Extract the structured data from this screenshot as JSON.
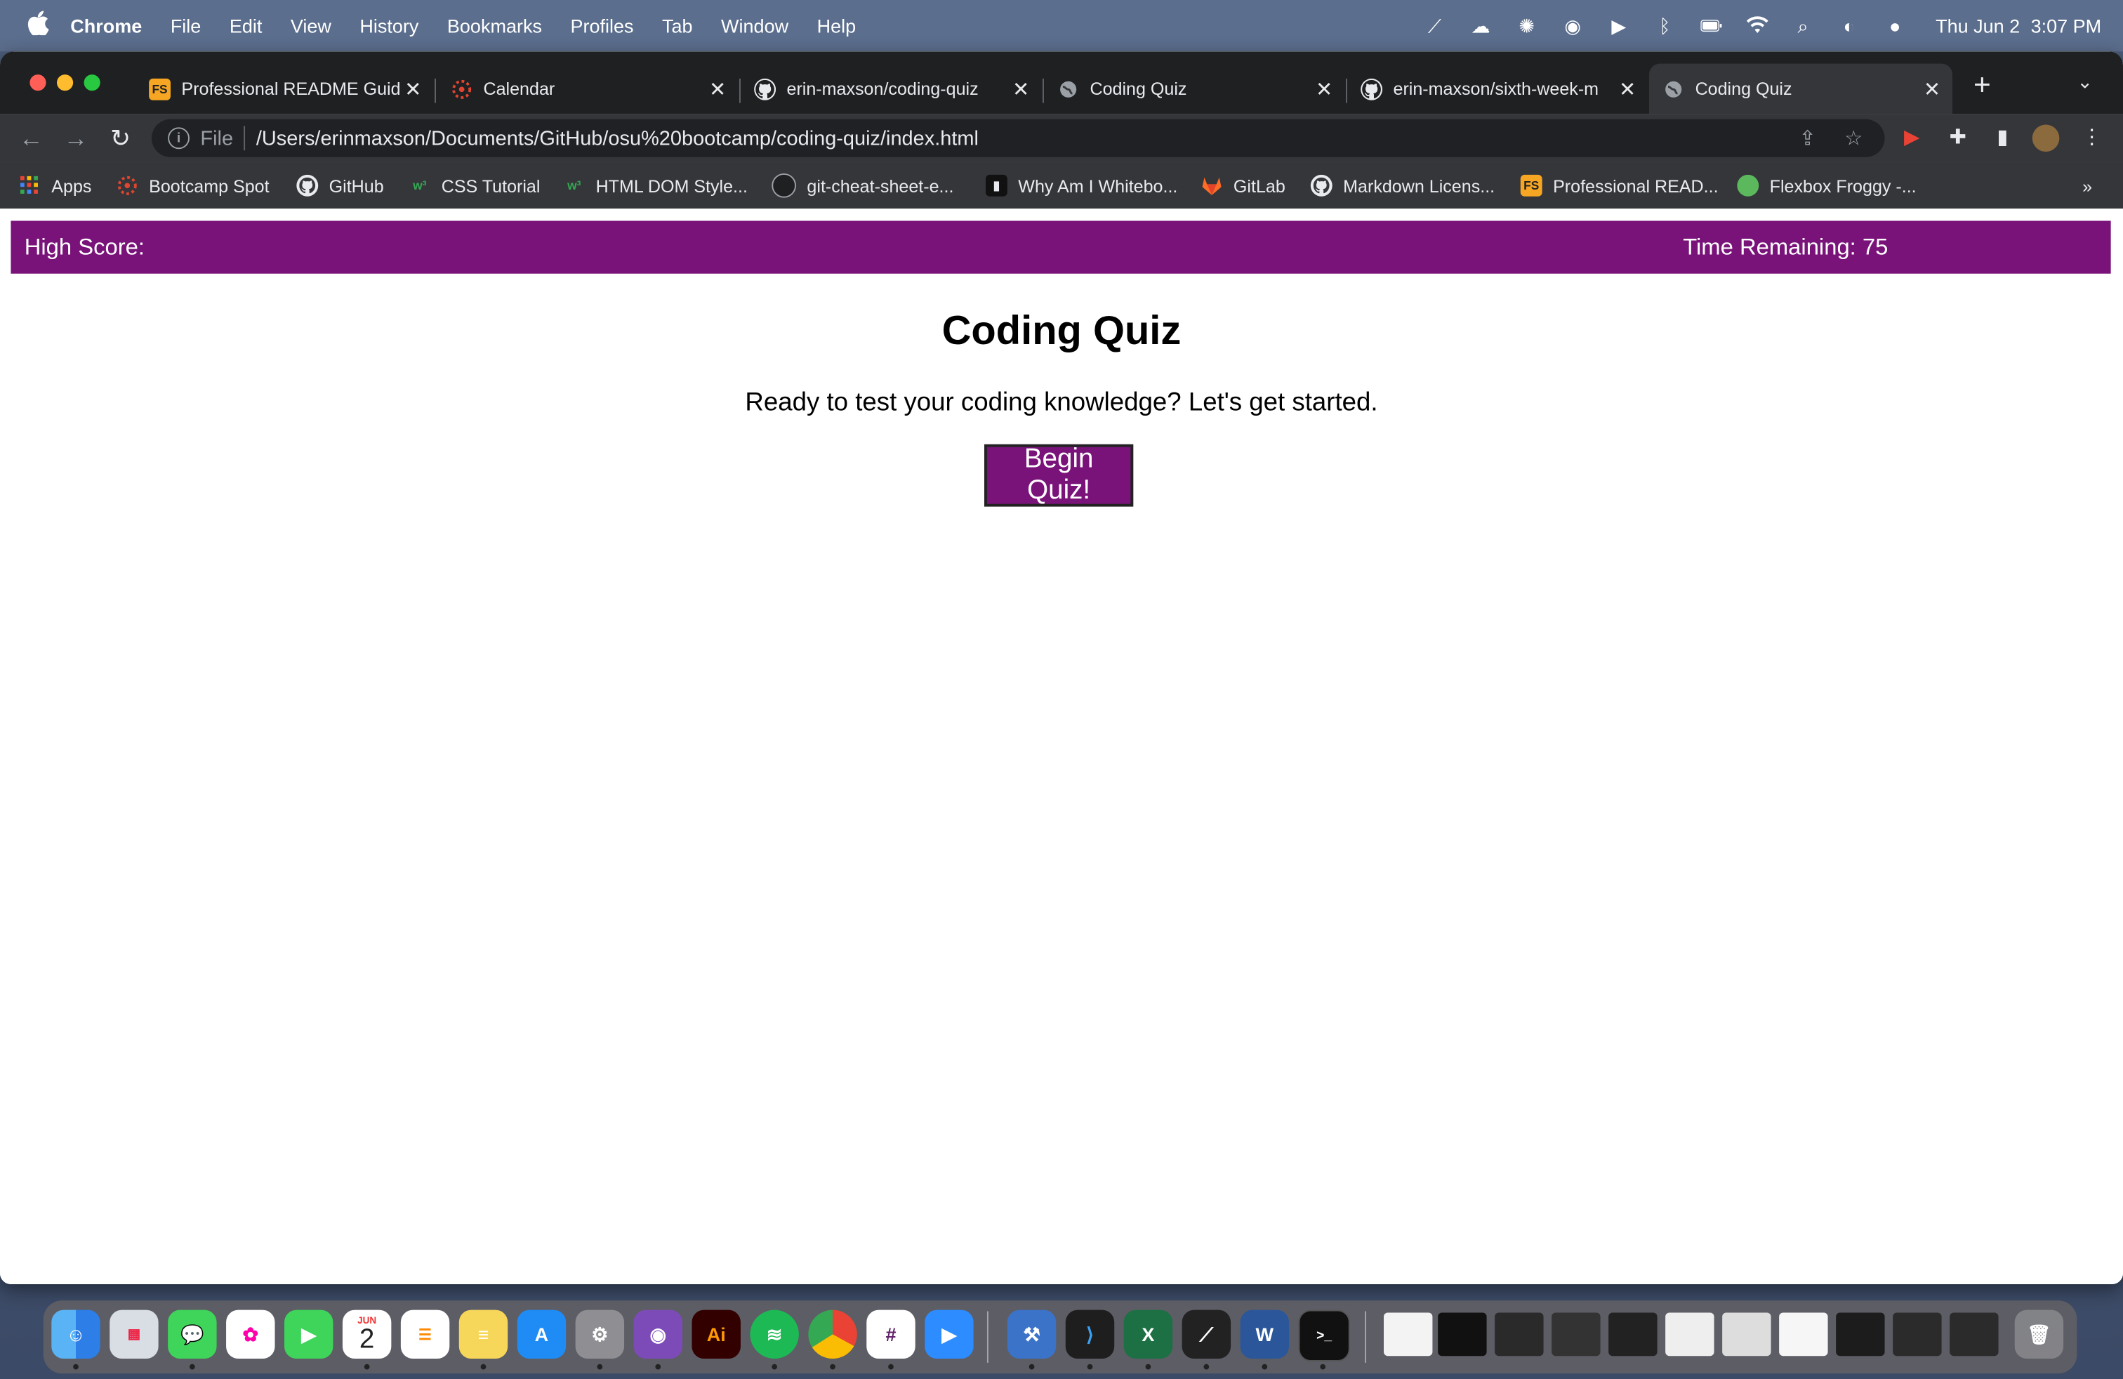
{
  "menubar": {
    "app_name": "Chrome",
    "items": [
      "File",
      "Edit",
      "View",
      "History",
      "Bookmarks",
      "Profiles",
      "Tab",
      "Window",
      "Help"
    ],
    "date": "Thu Jun 2",
    "time": "3:07 PM"
  },
  "tabs": [
    {
      "label": "Professional README Guid",
      "favicon": "FS",
      "favicon_color": "#f6a623",
      "active": false
    },
    {
      "label": "Calendar",
      "favicon": "canvas-icon",
      "favicon_color": "#e0452f",
      "active": false
    },
    {
      "label": "erin-maxson/coding-quiz",
      "favicon": "github-icon",
      "active": false
    },
    {
      "label": "Coding Quiz",
      "favicon": "globe-icon",
      "active": false
    },
    {
      "label": "erin-maxson/sixth-week-m",
      "favicon": "github-icon",
      "active": false
    },
    {
      "label": "Coding Quiz",
      "favicon": "globe-icon",
      "active": true
    }
  ],
  "address_bar": {
    "scheme": "File",
    "url": "/Users/erinmaxson/Documents/GitHub/osu%20bootcamp/coding-quiz/index.html"
  },
  "bookmarks": [
    {
      "label": "Apps",
      "icon": "apps-grid-icon"
    },
    {
      "label": "Bootcamp Spot",
      "icon": "canvas-icon"
    },
    {
      "label": "GitHub",
      "icon": "github-icon"
    },
    {
      "label": "CSS Tutorial",
      "icon": "w3schools-icon"
    },
    {
      "label": "HTML DOM Style...",
      "icon": "w3schools-icon"
    },
    {
      "label": "git-cheat-sheet-e...",
      "icon": "github-icon"
    },
    {
      "label": "Why Am I Whitebo...",
      "icon": "book-icon"
    },
    {
      "label": "GitLab",
      "icon": "gitlab-icon"
    },
    {
      "label": "Markdown Licens...",
      "icon": "github-icon"
    },
    {
      "label": "Professional READ...",
      "icon": "FS"
    },
    {
      "label": "Flexbox Froggy -...",
      "icon": "frog-icon"
    }
  ],
  "page": {
    "high_score_label": "High Score:",
    "time_remaining_label": "Time Remaining: 75",
    "title": "Coding Quiz",
    "subtitle": "Ready to test your coding knowledge? Let's get started.",
    "begin_button": "Begin Quiz!",
    "accent_color": "#79137a"
  },
  "dock": {
    "calendar_month": "JUN",
    "calendar_day": "2",
    "illustrator_label": "Ai"
  }
}
